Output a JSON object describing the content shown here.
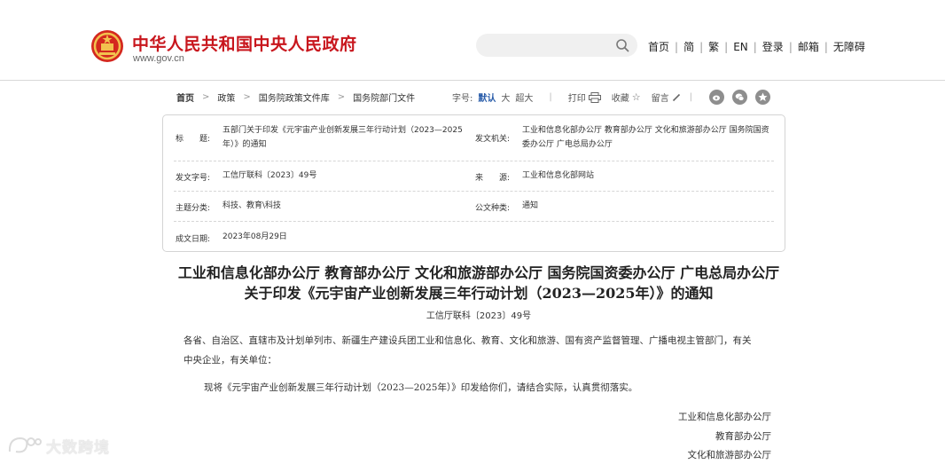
{
  "header": {
    "site_title": "中华人民共和国中央人民政府",
    "site_url": "www.gov.cn",
    "search_placeholder": "",
    "links": [
      "首页",
      "简",
      "繁",
      "EN",
      "登录",
      "邮箱",
      "无障碍"
    ],
    "brand_color": "#c8161d"
  },
  "breadcrumb": [
    "首页",
    "政策",
    "国务院政策文件库",
    "国务院部门文件"
  ],
  "toolbar": {
    "font_label": "字号:",
    "font_default": "默认",
    "font_large": "大",
    "font_xlarge": "超大",
    "print": "打印",
    "favorite": "收藏",
    "comment": "留言",
    "active_color": "#2a5daa"
  },
  "meta": {
    "title_label": "标　　题:",
    "title_value": "五部门关于印发《元宇宙产业创新发展三年行动计划（2023—2025年）》的通知",
    "issuer_label": "发文机关:",
    "issuer_value": "工业和信息化部办公厅  教育部办公厅  文化和旅游部办公厅  国务院国资委办公厅  广电总局办公厅",
    "doc_no_label": "发文字号:",
    "doc_no_value": "工信厅联科〔2023〕49号",
    "source_label": "来　　源:",
    "source_value": "工业和信息化部网站",
    "category_label": "主题分类:",
    "category_value": "科技、教育\\科技",
    "type_label": "公文种类:",
    "type_value": "通知",
    "date_label": "成文日期:",
    "date_value": "2023年08月29日"
  },
  "document": {
    "title": "工业和信息化部办公厅  教育部办公厅  文化和旅游部办公厅  国务院国资委办公厅  广电总局办公厅关于印发《元宇宙产业创新发展三年行动计划（2023—2025年）》的通知",
    "number": "工信厅联科〔2023〕49号",
    "recipients": "各省、自治区、直辖市及计划单列市、新疆生产建设兵团工业和信息化、教育、文化和旅游、国有资产监督管理、广播电视主管部门，有关中央企业，有关单位：",
    "body": "现将《元宇宙产业创新发展三年行动计划（2023—2025年）》印发给你们，请结合实际，认真贯彻落实。",
    "signatures": [
      "工业和信息化部办公厅",
      "教育部办公厅",
      "文化和旅游部办公厅"
    ]
  },
  "watermark": {
    "text": "大数跨境"
  }
}
